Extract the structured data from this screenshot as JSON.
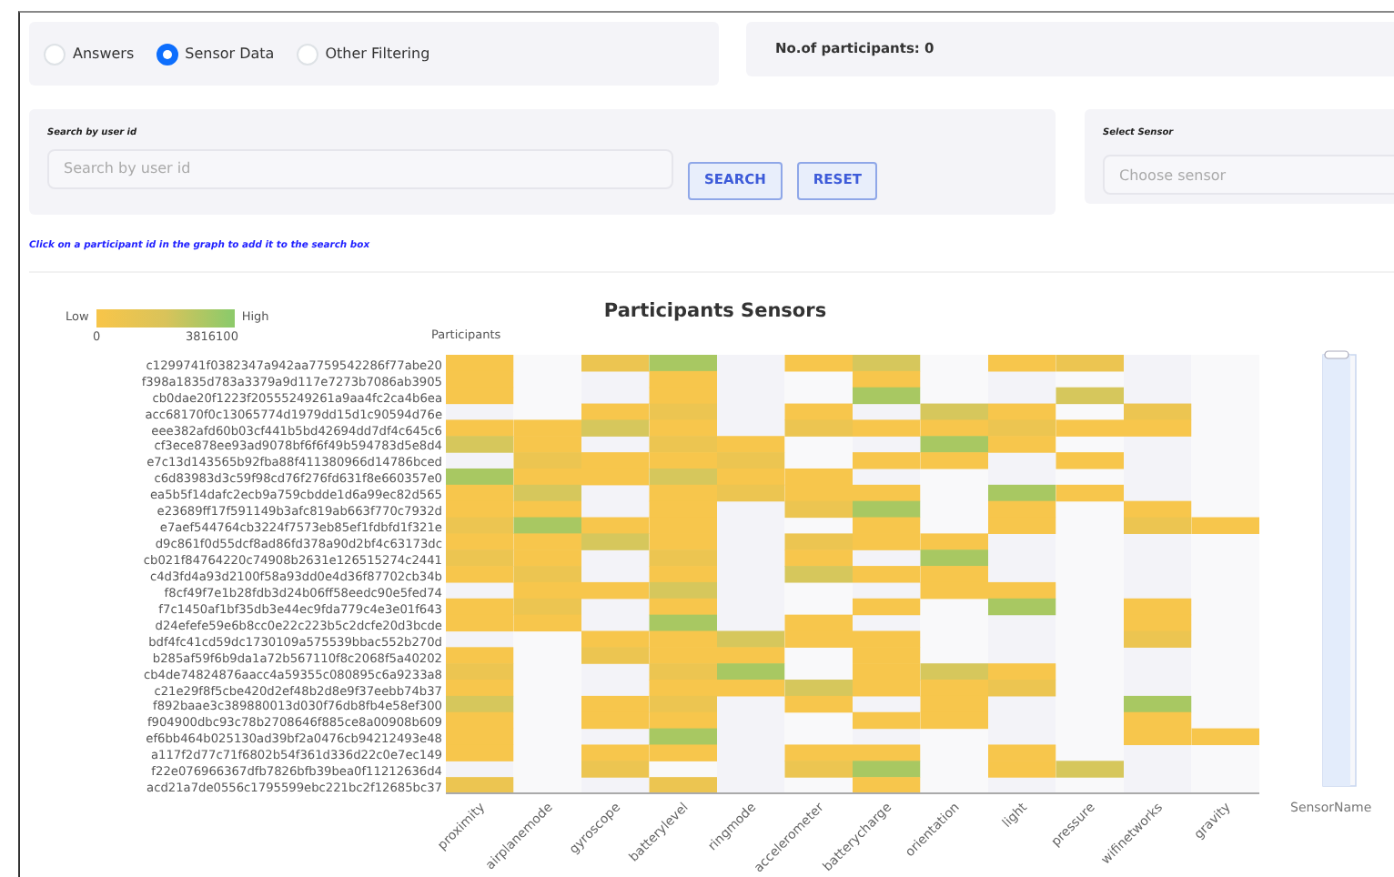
{
  "filters": [
    {
      "label": "Answers",
      "selected": false
    },
    {
      "label": "Sensor Data",
      "selected": true
    },
    {
      "label": "Other Filtering",
      "selected": false
    }
  ],
  "participants_count": {
    "label": "No.of participants:",
    "value": "0"
  },
  "user_search": {
    "label": "Search by user id",
    "placeholder": "Search by user id",
    "buttons": [
      "SEARCH",
      "RESET"
    ]
  },
  "sensor_select": {
    "label": "Select Sensor",
    "placeholder": "Choose sensor"
  },
  "hint": "Click on a participant id in the graph to add it to the search box",
  "chart": {
    "range_slider": {
      "level": 1
    },
    "title": "Participants Sensors",
    "legend": {
      "low": "Low",
      "high": "High",
      "min": "0",
      "max": "3816100"
    },
    "ylabel": "Participants",
    "xlabel": "SensorName",
    "participants": [
      "c1299741f0382347a942aa7759542286f77abe20",
      "f398a1835d783a3379a9d117e7273b7086ab3905",
      "cb0dae20f1223f20555249261a9aa4fc2ca4b6ea",
      "acc68170f0c13065774d1979dd15d1c90594d76e",
      "eee382afd60b03cf441b5bd42694dd7df4c645c6",
      "cf3ece878ee93ad9078bf6f6f49b594783d5e8d4",
      "e7c13d143565b92fba88f411380966d14786bced",
      "c6d83983d3c59f98cd76f276fd631f8e660357e0",
      "ea5b5f14dafc2ecb9a759cbdde1d6a99ec82d565",
      "e23689ff17f591149b3afc819ab663f770c7932d",
      "e7aef544764cb3224f7573eb85ef1fdbfd1f321e",
      "d9c861f0d55dcf8ad86fd378a90d2bf4c63173dc",
      "cb021f84764220c74908b2631e126515274c2441",
      "c4d3fd4a93d2100f58a93dd0e4d36f87702cb34b",
      "f8cf49f7e1b28fdb3d24b06ff58eedc90e5fed74",
      "f7c1450af1bf35db3e44ec9fda779c4e3e01f643",
      "d24efefe59e6b8cc0e22c223b5c2dcfe20d3bcde",
      "bdf4fc41cd59dc1730109a575539bbac552b270d",
      "b285af59f6b9da1a72b567110f8c2068f5a40202",
      "cb4de74824876aacc4a59355c080895c6a9233a8",
      "c21e29f8f5cbe420d2ef48b2d8e9f37eebb74b37",
      "f892baae3c389880013d030f76db8fb4e58ef300",
      "f904900dbc93c78b2708646f885ce8a00908b609",
      "ef6bb464b025130ad39bf2a0476cb94212493e48",
      "a117f2d77c71f6802b54f361d336d22c0e7ec149",
      "f22e076966367dfb7826bfb39bea0f11212636d4",
      "acd21a7de0556c1795599ebc221bc2f12685bc37"
    ],
    "sensors": [
      "proximity",
      "airplanemode",
      "gyroscope",
      "batterylevel",
      "ringmode",
      "accelerometer",
      "batterycharge",
      "orientation",
      "light",
      "pressure",
      "wifinetworks",
      "gravity"
    ]
  }
}
